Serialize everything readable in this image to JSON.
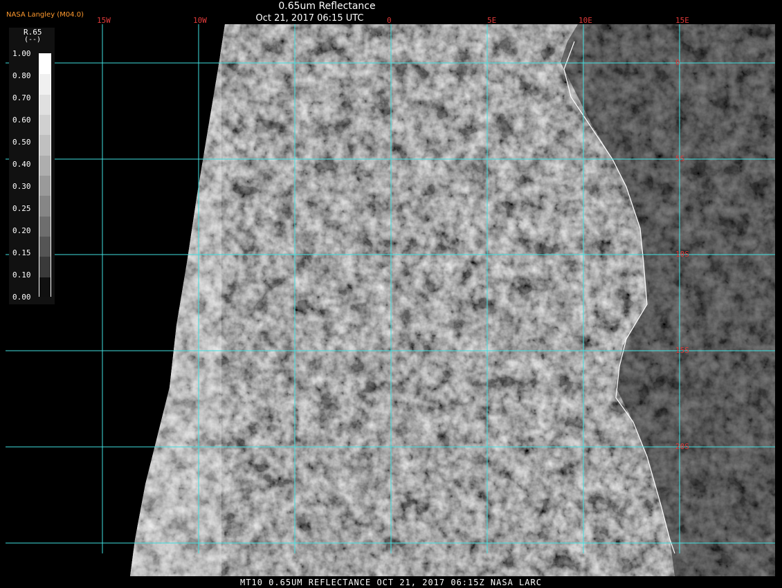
{
  "header": {
    "title": "0.65um Reflectance",
    "subtitle": "Oct 21, 2017 06:15 UTC",
    "credit": "NASA Langley (M04.0)"
  },
  "footer": {
    "text": "MT10  0.65UM REFLECTANCE   OCT 21, 2017 06:15Z   NASA LARC"
  },
  "legend": {
    "name": "R.65",
    "unit": "(--)",
    "ticks": [
      "1.00",
      "0.80",
      "0.70",
      "0.60",
      "0.50",
      "0.40",
      "0.30",
      "0.25",
      "0.20",
      "0.15",
      "0.10",
      "0.00"
    ],
    "shades": [
      "#ffffff",
      "#f0f0f0",
      "#e0e0e0",
      "#d0d0d0",
      "#c0c0c0",
      "#aeaeae",
      "#9a9a9a",
      "#868686",
      "#6e6e6e",
      "#555555",
      "#3a3a3a",
      "#101010"
    ]
  },
  "map": {
    "longitude_labels": [
      "15W",
      "10W",
      "0",
      "5E",
      "10E",
      "15E"
    ],
    "latitude_labels": [
      "0",
      "5S",
      "10S",
      "15S",
      "20S"
    ],
    "grid_color": "#3fe0e0",
    "label_color": "#e03a3a"
  }
}
